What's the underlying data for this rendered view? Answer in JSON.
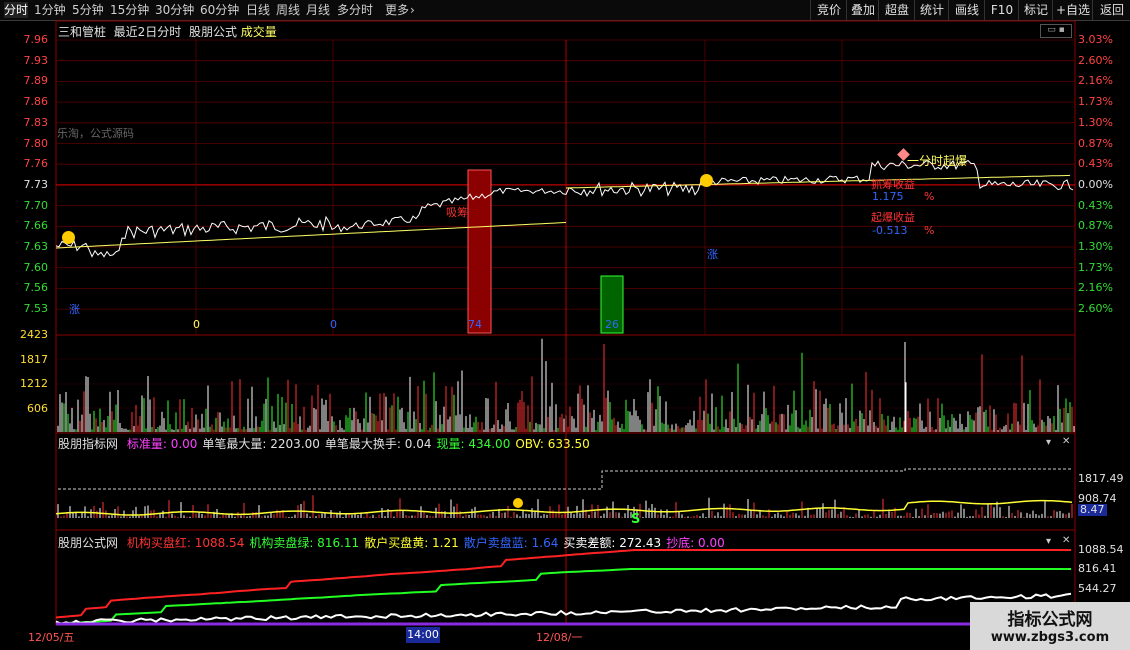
{
  "toolbar": {
    "left_tabs": [
      "分时",
      "1分钟",
      "5分钟",
      "15分钟",
      "30分钟",
      "60分钟",
      "日线",
      "周线",
      "月线",
      "多分时",
      "更多"
    ],
    "more_chevron": "›",
    "right_tabs": [
      "竞价",
      "叠加",
      "超盘",
      "统计",
      "画线",
      "F10",
      "标记",
      "+自选",
      "返回"
    ]
  },
  "main_panel": {
    "stock_name": "三和管桩",
    "period": "最近2日分时",
    "formula": "股朋公式",
    "volume_label": "成交量",
    "left_axis": [
      "7.96",
      "7.93",
      "7.89",
      "7.86",
      "7.83",
      "7.80",
      "7.76",
      "7.73",
      "7.70",
      "7.66",
      "7.63",
      "7.60",
      "7.56",
      "7.53"
    ],
    "right_axis": [
      "3.03%",
      "2.60%",
      "2.16%",
      "1.73%",
      "1.30%",
      "0.87%",
      "0.43%",
      "0.00%",
      "0.43%",
      "0.87%",
      "1.30%",
      "1.73%",
      "2.16%",
      "2.60%"
    ],
    "watermark_text": "乐淘，公式源码",
    "annotations": {
      "xiji": "吸筹",
      "zhang1": "涨",
      "zhang2": "涨",
      "num0a": "0",
      "num0b": "0",
      "num74": "74",
      "num26": "26",
      "flag": "一分时起爆",
      "buy_profit_label": "抓筹收益",
      "buy_profit_value": "1.175",
      "buy_profit_pct": "%",
      "boom_profit_label": "起爆收益",
      "boom_profit_value": "-0.513",
      "boom_profit_pct": "%"
    }
  },
  "volume_panel": {
    "axis": [
      "2423",
      "1817",
      "1212",
      "606"
    ]
  },
  "indicator1": {
    "name": "股朋指标网",
    "items": [
      {
        "label": "标准量:",
        "value": "0.00",
        "color": "#ff40ff"
      },
      {
        "label": "单笔最大量:",
        "value": "2203.00",
        "color": "#e0e0e0"
      },
      {
        "label": "单笔最大换手:",
        "value": "0.04",
        "color": "#e0e0e0"
      },
      {
        "label": "现量:",
        "value": "434.00",
        "color": "#33ff33"
      },
      {
        "label": "OBV:",
        "value": "633.50",
        "color": "#ffff33"
      }
    ],
    "axis": [
      "1817.49",
      "908.74",
      "8.47"
    ],
    "s_mark": "S"
  },
  "indicator2": {
    "name": "股朋公式网",
    "items": [
      {
        "label": "机构买盘红:",
        "value": "1088.54",
        "color": "#ff3333"
      },
      {
        "label": "机构卖盘绿:",
        "value": "816.11",
        "color": "#33ff33"
      },
      {
        "label": "散户买盘黄:",
        "value": "1.21",
        "color": "#ffff33"
      },
      {
        "label": "散户卖盘蓝:",
        "value": "1.64",
        "color": "#3366ff"
      },
      {
        "label": "买卖差额:",
        "value": "272.43",
        "color": "#ffffff"
      },
      {
        "label": "抄底:",
        "value": "0.00",
        "color": "#ff40ff"
      }
    ],
    "axis": [
      "1088.54",
      "816.41",
      "544.27"
    ]
  },
  "time_axis": {
    "d1": "12/05/五",
    "time": "14:00",
    "d2": "12/08/一"
  },
  "site": {
    "name": "指标公式网",
    "url": "www.zbgs3.com"
  },
  "colors": {
    "grid_red": "#8b0000",
    "price_line": "#ffffff",
    "avg_line": "#ffff66",
    "up": "#ff3333",
    "down": "#33ff33"
  }
}
